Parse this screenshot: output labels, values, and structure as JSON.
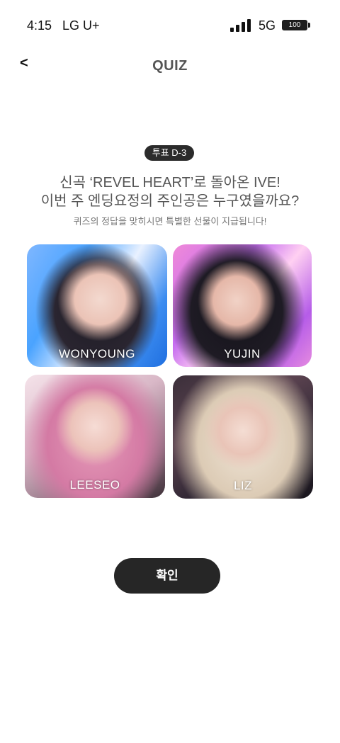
{
  "status_bar": {
    "time": "4:15",
    "carrier": "LG U+",
    "network": "5G",
    "battery": "100"
  },
  "header": {
    "back_label": "<",
    "title": "QUIZ"
  },
  "quiz": {
    "badge": "투표 D-3",
    "question_line1": "신곡 ‘REVEL HEART’로 돌아온 IVE!",
    "question_line2": "이번 주 엔딩요정의 주인공은 누구였을까요?",
    "hint": "퀴즈의 정답을 맞히시면 특별한 선물이 지급됩니다!"
  },
  "options": [
    {
      "name": "WONYOUNG"
    },
    {
      "name": "YUJIN"
    },
    {
      "name": "LEESEO"
    },
    {
      "name": "LIZ"
    }
  ],
  "confirm_label": "확인"
}
